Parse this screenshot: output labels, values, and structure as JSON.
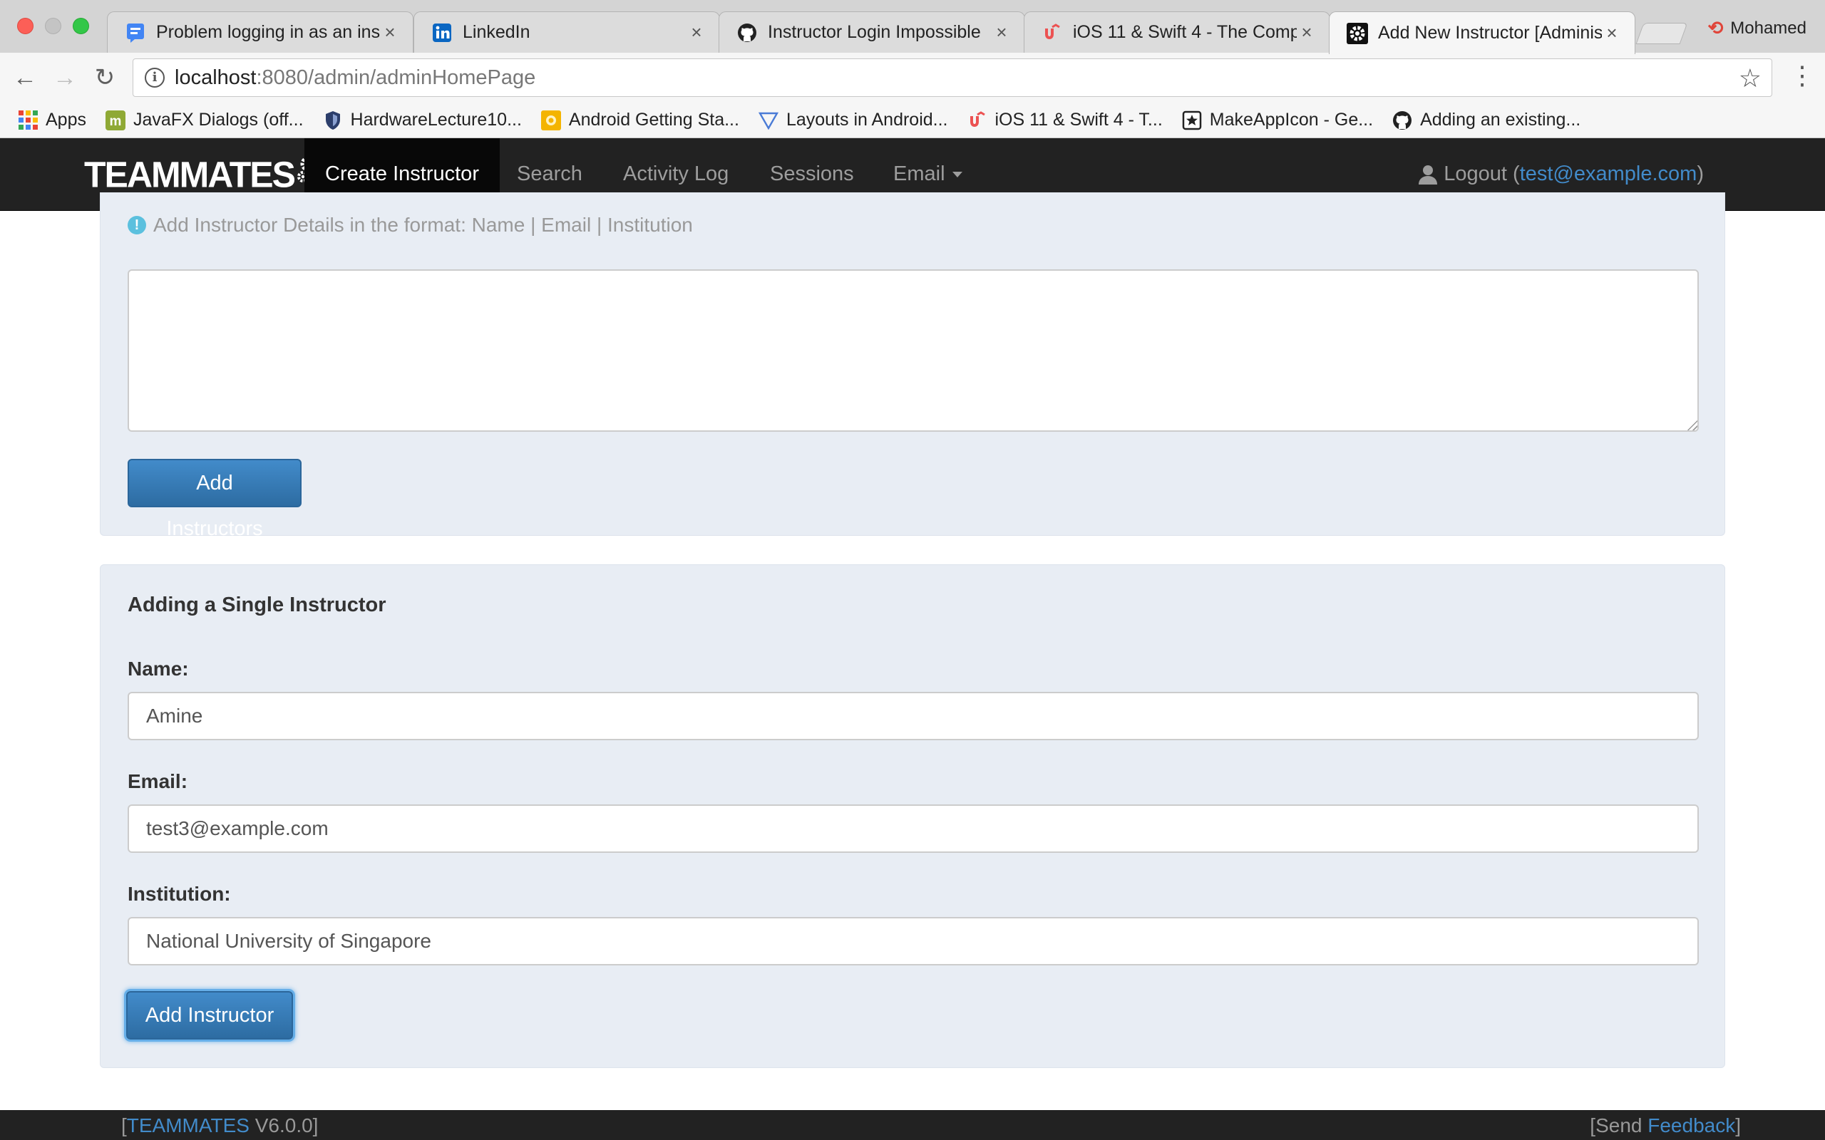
{
  "browser": {
    "tabs": [
      {
        "title": "Problem logging in as an ins",
        "favicon": "google-forum-icon",
        "active": false
      },
      {
        "title": "LinkedIn",
        "favicon": "linkedin-icon",
        "active": false
      },
      {
        "title": "Instructor Login Impossible",
        "favicon": "github-icon",
        "active": false
      },
      {
        "title": "iOS 11 & Swift 4 - The Comp",
        "favicon": "udemy-icon",
        "active": false
      },
      {
        "title": "Add New Instructor [Adminis",
        "favicon": "teammates-gear-icon",
        "active": true
      }
    ],
    "profile_name": "Mohamed",
    "url_host": "localhost",
    "url_path": ":8080/admin/adminHomePage",
    "bookmarks": [
      {
        "label": "Apps",
        "icon": "apps-grid-icon"
      },
      {
        "label": "JavaFX Dialogs (off...",
        "icon": "m-icon"
      },
      {
        "label": "HardwareLecture10...",
        "icon": "shield-icon"
      },
      {
        "label": "Android Getting Sta...",
        "icon": "android-icon"
      },
      {
        "label": "Layouts in Android...",
        "icon": "triangle-icon"
      },
      {
        "label": "iOS 11 & Swift 4 - T...",
        "icon": "udemy-icon"
      },
      {
        "label": "MakeAppIcon - Ge...",
        "icon": "star-box-icon"
      },
      {
        "label": "Adding an existing...",
        "icon": "github-icon"
      }
    ]
  },
  "navbar": {
    "brand": "TEAMMATES",
    "items": [
      {
        "label": "Create Instructor",
        "active": true
      },
      {
        "label": "Search",
        "active": false
      },
      {
        "label": "Activity Log",
        "active": false
      },
      {
        "label": "Sessions",
        "active": false
      },
      {
        "label": "Email",
        "active": false
      }
    ],
    "logout_label": "Logout (",
    "user_email": "test@example.com",
    "logout_close": ")"
  },
  "multi": {
    "hint": "Add Instructor Details in the format: Name | Email | Institution",
    "textarea_value": "",
    "button": "Add Instructors"
  },
  "single": {
    "title": "Adding a Single Instructor",
    "name_label": "Name:",
    "name_value": "Amine",
    "email_label": "Email:",
    "email_value": "test3@example.com",
    "institution_label": "Institution:",
    "institution_value": "National University of Singapore",
    "button": "Add Instructor"
  },
  "footer": {
    "left_open": "[",
    "product": "TEAMMATES",
    "version": " V6.0.0]",
    "right_open": "[Send ",
    "feedback": "Feedback",
    "right_close": "]"
  },
  "colors": {
    "navbar_bg": "#222222",
    "well_bg": "#e8edf4",
    "primary_button": "#337ab7",
    "link": "#428bca"
  }
}
